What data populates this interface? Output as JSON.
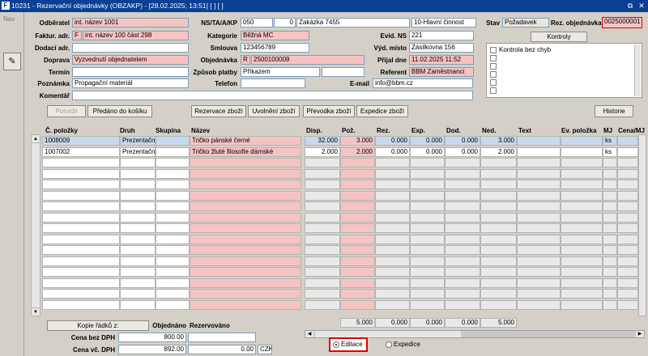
{
  "window": {
    "title": "10231 - Rezervační objednávky (OBZAKP) - [28.02.2025; 13:51]  [  ]  [  ]",
    "nav_label": "Nav",
    "restore_glyph": "⧉",
    "close_glyph": "✕"
  },
  "header": {
    "labels": {
      "odberatel": "Odběratel",
      "faktur_adr": "Faktur. adr.",
      "dodaci_adr": "Dodací adr.",
      "doprava": "Doprava",
      "termin": "Termín",
      "poznamka": "Poznámka",
      "komentar": "Komentář",
      "ns_ta_a_kp": "NS/TA/A/KP",
      "kategorie": "Kategorie",
      "smlouva": "Smlouva",
      "objednavka": "Objednávka",
      "zpusob_platby": "Způsob platby",
      "telefon": "Telefon",
      "evid_ns": "Evid. NS",
      "vyd_misto": "Výd. místo",
      "prijal_dne": "Přijal dne",
      "referent": "Referent",
      "email": "E-mail",
      "stav": "Stav",
      "rez_objednavka": "Rez. objednávka"
    },
    "values": {
      "odberatel": "int. název 1001",
      "faktur_adr_flag": "F",
      "faktur_adr": "int. název 100 část 298",
      "dodaci_adr": "",
      "doprava": "Vyzvednutí objednatelem",
      "termin": "",
      "poznamka": "Propagační materiál",
      "komentar": "",
      "ns": "050",
      "ta": "0",
      "zakazka": "Zakázka 7455",
      "cinnost": "10-Hlavní činnost",
      "kategorie": "Běžná MC",
      "smlouva": "123456789",
      "objednavka_flag": "R",
      "objednavka": "2500100009",
      "zpusob_platby": "Příkazem",
      "telefon": "",
      "evid_ns": "221",
      "vyd_misto": "Zásilkovna 156",
      "prijal_dne": "11.02.2025 11:52",
      "referent": "BBM Zaměstnanci",
      "email": "info@bbm.cz",
      "stav": "Požadavek",
      "rez_objednavka": "0025000001"
    }
  },
  "kontroly": {
    "title": "Kontroly",
    "items": [
      "Kontrola bez chyb",
      "",
      "",
      "",
      "",
      ""
    ]
  },
  "toolbar": {
    "potvrdit": "Potvrdit",
    "predano": "Předáno do košíku",
    "rezervace": "Rezervace zboží",
    "uvolneni": "Uvolnění zboží",
    "prevodka": "Převodka zboží",
    "expedice": "Expedice zboží",
    "historie": "Historie"
  },
  "grid": {
    "columns": [
      "Č. položky",
      "Druh",
      "Skupina",
      "Název",
      "Disp.",
      "Pož.",
      "Rez.",
      "Exp.",
      "Dod.",
      "Ned.",
      "Text",
      "Ev. položka",
      "MJ",
      "Cena/MJ"
    ],
    "rows": [
      {
        "polozka": "1008009",
        "druh": "Prezentační",
        "skupina": "",
        "nazev": "Tričko pánské černé",
        "disp": "32.000",
        "poz": "3.000",
        "rez": "0.000",
        "exp": "0.000",
        "dod": "0.000",
        "ned": "3.000",
        "text": "",
        "ev": "",
        "mj": "ks",
        "cena": ""
      },
      {
        "polozka": "1007002",
        "druh": "Prezentační",
        "skupina": "",
        "nazev": "Tričko žluté filosofie dámské",
        "disp": "2.000",
        "poz": "2.000",
        "rez": "0.000",
        "exp": "0.000",
        "dod": "0.000",
        "ned": "2.000",
        "text": "",
        "ev": "",
        "mj": "ks",
        "cena": ""
      }
    ],
    "totals": {
      "poz": "5.000",
      "rez": "0.000",
      "exp": "0.000",
      "dod": "0.000",
      "ned": "5.000"
    }
  },
  "footer": {
    "kopie_button": "Kopie řádků z:",
    "objednano_label": "Objednáno",
    "rezervovano_label": "Rezervováno",
    "cena_bez_dph_label": "Cena bez DPH",
    "cena_vc_dph_label": "Cena vč. DPH",
    "cena_bez_dph": "800.00",
    "cena_vc_dph": "892.00",
    "rez_bez_dph": "",
    "rez_vc_dph": "0.00",
    "currency": "CZK",
    "mode_editace": "Editace",
    "mode_expedice": "Expedice"
  },
  "colors": {
    "title_bg": "#0a3f93",
    "pink_field": "#f6c3c3",
    "highlight_row": "#c7d9ee",
    "red_outline": "#e00000"
  }
}
